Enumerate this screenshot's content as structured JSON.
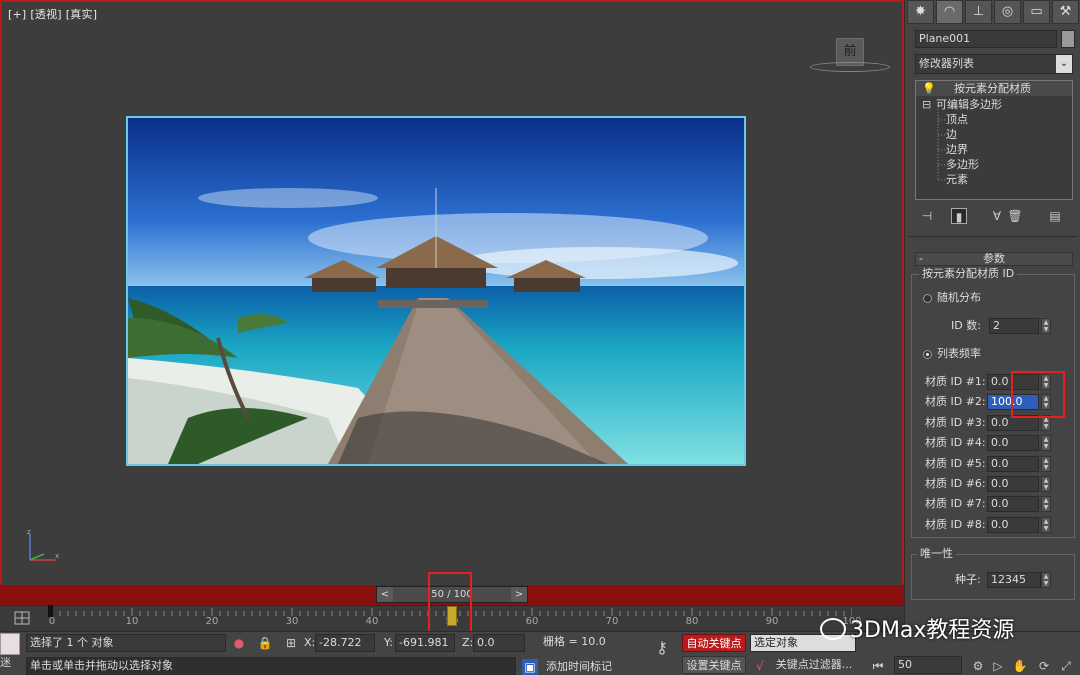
{
  "viewport": {
    "label_plus": "[+]",
    "label_view": "[透视]",
    "label_shading": "[真实]",
    "viewcube_face": "前"
  },
  "time_slider": {
    "prev": "<",
    "next": ">",
    "text": "50 / 100"
  },
  "ruler": {
    "labels": [
      "0",
      "10",
      "20",
      "30",
      "40",
      "50",
      "60",
      "70",
      "80",
      "90",
      "100"
    ]
  },
  "status": {
    "selection_text": "选择了 1 个 对象",
    "prompt_text": "单击或单击并拖动以选择对象",
    "x_label": "X:",
    "x_value": "-28.722",
    "y_label": "Y:",
    "y_value": "-691.981",
    "z_label": "Z:",
    "z_value": "0.0",
    "grid_text": "栅格 = 10.0",
    "add_time_tag": "添加时间标记",
    "auto_key": "自动关键点",
    "set_key": "设置关键点",
    "selected_object": "选定对象",
    "key_filters": "关键点过滤器...",
    "frame_value": "50",
    "left_cut": "迷"
  },
  "panel": {
    "tabs": [
      "create-icon",
      "modify-icon",
      "hierarchy-icon",
      "motion-icon",
      "display-icon",
      "utilities-icon"
    ],
    "object_name": "Plane001",
    "modifier_list": "修改器列表",
    "stack": {
      "top": "按元素分配材质",
      "base": "可编辑多边形",
      "subs": [
        "顶点",
        "边",
        "边界",
        "多边形",
        "元素"
      ]
    },
    "rollout_minus": "-",
    "rollout_title": "参数",
    "group_title": "按元素分配材质 ID",
    "random_label": "随机分布",
    "id_count_label": "ID 数:",
    "id_count_value": "2",
    "list_freq_label": "列表频率",
    "materials": [
      {
        "label": "材质 ID #1:",
        "value": "0.0"
      },
      {
        "label": "材质 ID #2:",
        "value": "100.0"
      },
      {
        "label": "材质 ID #3:",
        "value": "0.0"
      },
      {
        "label": "材质 ID #4:",
        "value": "0.0"
      },
      {
        "label": "材质 ID #5:",
        "value": "0.0"
      },
      {
        "label": "材质 ID #6:",
        "value": "0.0"
      },
      {
        "label": "材质 ID #7:",
        "value": "0.0"
      },
      {
        "label": "材质 ID #8:",
        "value": "0.0"
      }
    ],
    "unique_title": "唯一性",
    "seed_label": "种子:",
    "seed_value": "12345"
  },
  "watermark": "3DMax教程资源",
  "colors": {
    "accent_red": "#b81b1b",
    "viewport_bg": "#3d3d3d",
    "selection_blue": "#2d5fb8",
    "frame_marker": "#c9a92a"
  }
}
